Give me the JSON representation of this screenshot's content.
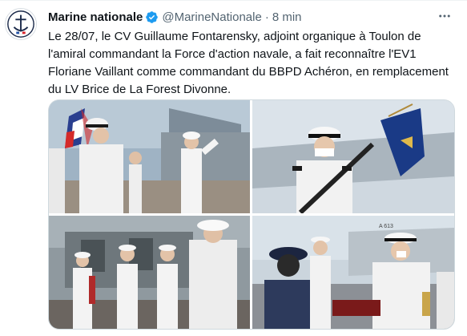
{
  "tweet": {
    "author_name": "Marine nationale",
    "handle": "@MarineNationale",
    "separator": "·",
    "timestamp": "8 min",
    "text_lines": [
      "Le 28/07, le CV Guillaume Fontarensky, adjoint organique à Toulon de",
      "l'amiral commandant la Force d'action navale, a fait reconnaître l'EV1",
      "Floriane Vaillant comme commandant du BBPD Achéron, en remplacement",
      "du LV Brice de La Forest Divonne."
    ]
  },
  "icons": {
    "avatar": "marine-nationale-logo",
    "verified": "verified-badge-icon",
    "more": "more-options-icon"
  },
  "colors": {
    "verified_blue": "#1d9bf0",
    "secondary_text": "#536471",
    "primary_text": "#0f1419",
    "border": "#cfd9de"
  },
  "media": {
    "photo_count": 4,
    "photo4_ship_marking": "A 613"
  }
}
